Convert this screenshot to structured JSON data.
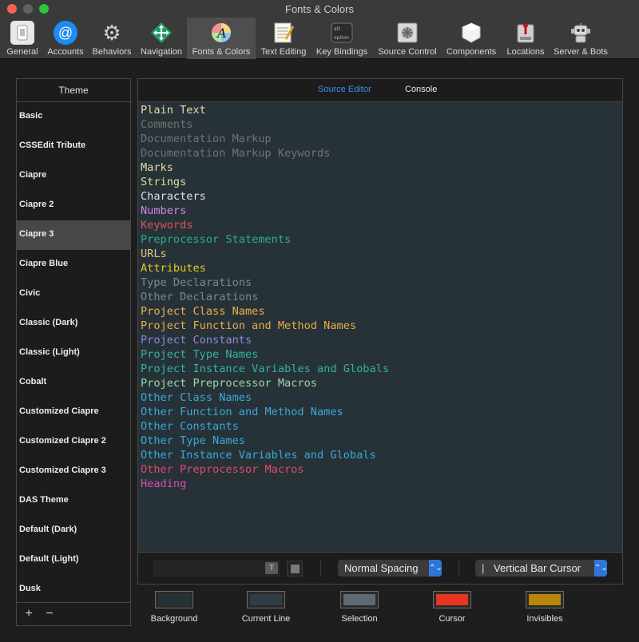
{
  "window": {
    "title": "Fonts & Colors"
  },
  "toolbar": {
    "items": [
      {
        "label": "General",
        "icon": "switch-icon"
      },
      {
        "label": "Accounts",
        "icon": "at-sign-icon"
      },
      {
        "label": "Behaviors",
        "icon": "gear-icon"
      },
      {
        "label": "Navigation",
        "icon": "compass-arrows-icon"
      },
      {
        "label": "Fonts & Colors",
        "icon": "font-color-icon"
      },
      {
        "label": "Text Editing",
        "icon": "notepad-icon"
      },
      {
        "label": "Key Bindings",
        "icon": "keyboard-key-icon"
      },
      {
        "label": "Source Control",
        "icon": "vault-icon"
      },
      {
        "label": "Components",
        "icon": "box-icon"
      },
      {
        "label": "Locations",
        "icon": "drive-icon"
      },
      {
        "label": "Server & Bots",
        "icon": "robot-icon"
      }
    ],
    "active_index": 4
  },
  "sidebar": {
    "header": "Theme",
    "themes": [
      "Basic",
      "CSSEdit Tribute",
      "Ciapre",
      "Ciapre 2",
      "Ciapre 3",
      "Ciapre Blue",
      "Civic",
      "Classic (Dark)",
      "Classic (Light)",
      "Cobalt",
      "Customized Ciapre",
      "Customized Ciapre 2",
      "Customized Ciapre 3",
      "DAS Theme",
      "Default (Dark)",
      "Default (Light)",
      "Dusk"
    ],
    "selected_index": 4,
    "add_label": "+",
    "remove_label": "−"
  },
  "editor": {
    "tabs": {
      "source": "Source Editor",
      "console": "Console"
    },
    "background_color": "#263238",
    "tokens": [
      {
        "label": "Plain Text",
        "color": "#e8d9a0"
      },
      {
        "label": "Comments",
        "color": "#727272"
      },
      {
        "label": "Documentation Markup",
        "color": "#727272"
      },
      {
        "label": "Documentation Markup Keywords",
        "color": "#727272"
      },
      {
        "label": "Marks",
        "color": "#e8d9a0"
      },
      {
        "label": "Strings",
        "color": "#e8d9a0"
      },
      {
        "label": "Characters",
        "color": "#e2e2e2"
      },
      {
        "label": "Numbers",
        "color": "#d087e6"
      },
      {
        "label": "Keywords",
        "color": "#d95757"
      },
      {
        "label": "Preprocessor Statements",
        "color": "#2bad8f"
      },
      {
        "label": "URLs",
        "color": "#d9c67a"
      },
      {
        "label": "Attributes",
        "color": "#e6c72a"
      },
      {
        "label": "Type Declarations",
        "color": "#7a8a90"
      },
      {
        "label": "Other Declarations",
        "color": "#7a8a90"
      },
      {
        "label": "Project Class Names",
        "color": "#f0b14a"
      },
      {
        "label": "Project Function and Method Names",
        "color": "#e8ad44"
      },
      {
        "label": "Project Constants",
        "color": "#8e88e0"
      },
      {
        "label": "Project Type Names",
        "color": "#34b2a0"
      },
      {
        "label": "Project Instance Variables and Globals",
        "color": "#34b2a0"
      },
      {
        "label": "Project Preprocessor Macros",
        "color": "#a2d6a0"
      },
      {
        "label": "Other Class Names",
        "color": "#3aa9d9"
      },
      {
        "label": "Other Function and Method Names",
        "color": "#3aa9d9"
      },
      {
        "label": "Other Constants",
        "color": "#3aa9d9"
      },
      {
        "label": "Other Type Names",
        "color": "#3aa9d9"
      },
      {
        "label": "Other Instance Variables and Globals",
        "color": "#3aa9d9"
      },
      {
        "label": "Other Preprocessor Macros",
        "color": "#e04a6a"
      },
      {
        "label": "Heading",
        "color": "#e04ab5"
      }
    ]
  },
  "footer": {
    "font_button_label": "T",
    "spacing": "Normal Spacing",
    "cursor": "Vertical Bar Cursor",
    "cursor_glyph": "|",
    "popup_arrow": "⌃⌄"
  },
  "wells": [
    {
      "label": "Background",
      "color": "#263238"
    },
    {
      "label": "Current Line",
      "color": "#2f3d45"
    },
    {
      "label": "Selection",
      "color": "#5b6a75"
    },
    {
      "label": "Cursor",
      "color": "#e8341c"
    },
    {
      "label": "Invisibles",
      "color": "#b8860b"
    }
  ]
}
